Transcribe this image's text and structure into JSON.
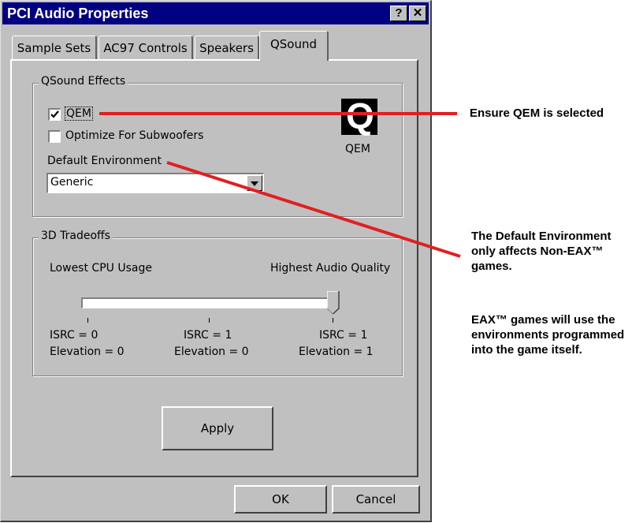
{
  "window": {
    "title": "PCI Audio Properties",
    "help_label": "?",
    "close_label": "✕"
  },
  "tabs": [
    {
      "label": "Sample Sets"
    },
    {
      "label": "AC97 Controls"
    },
    {
      "label": "Speakers"
    },
    {
      "label": "QSound",
      "active": true
    }
  ],
  "qsound_effects": {
    "legend": "QSound Effects",
    "qem_checkbox": {
      "label": "QEM",
      "checked": true
    },
    "subwoofer_checkbox": {
      "label": "Optimize For Subwoofers",
      "checked": false
    },
    "logo_letter": "Q",
    "logo_caption": "QEM",
    "default_env_label": "Default Environment",
    "default_env_value": "Generic"
  },
  "tradeoffs": {
    "legend": "3D Tradeoffs",
    "low_label": "Lowest CPU Usage",
    "high_label": "Highest Audio Quality",
    "slider_position": 1.0,
    "ticks": [
      {
        "isrc": "ISRC = 0",
        "elevation": "Elevation = 0"
      },
      {
        "isrc": "ISRC = 1",
        "elevation": "Elevation = 0"
      },
      {
        "isrc": "ISRC = 1",
        "elevation": "Elevation = 1"
      }
    ]
  },
  "buttons": {
    "apply": "Apply",
    "ok": "OK",
    "cancel": "Cancel"
  },
  "callouts": {
    "qem": "Ensure QEM is selected",
    "env_note": "The Default Environment only affects Non-EAX™ games.",
    "eax_note": "EAX™ games will use the environments programmed into the game itself."
  },
  "colors": {
    "titlebar": "#000080",
    "dialog_face": "#c0c0c0",
    "callout_line": "#e02020"
  }
}
